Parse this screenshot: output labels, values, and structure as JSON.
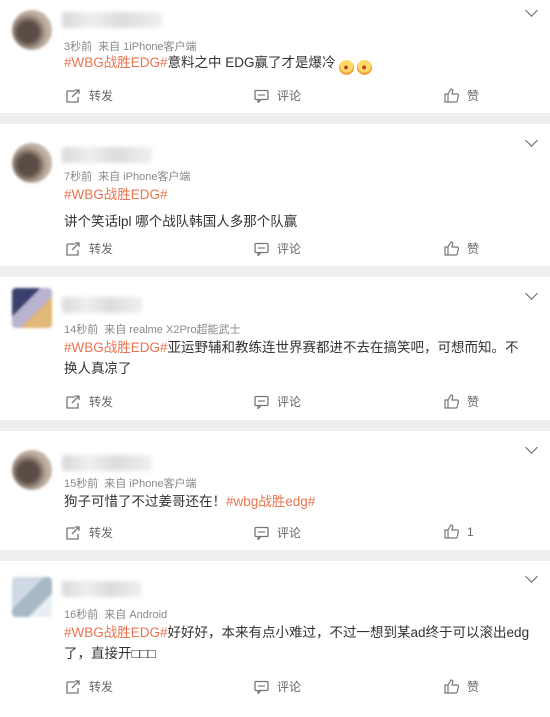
{
  "posts": [
    {
      "meta_time": "3秒前",
      "meta_source": "来自 1iPhone客户端",
      "hashtag": "#WBG战胜EDG#",
      "text": "意料之中 EDG赢了才是爆冷",
      "emojis": [
        "吃瓜",
        "吃瓜"
      ],
      "repost": "转发",
      "comment": "评论",
      "like": "赞"
    },
    {
      "meta_time": "7秒前",
      "meta_source": "来自 iPhone客户端",
      "hashtag": "#WBG战胜EDG#",
      "text": "讲个笑话lpl 哪个战队韩国人多那个队赢",
      "repost": "转发",
      "comment": "评论",
      "like": "赞"
    },
    {
      "meta_time": "14秒前",
      "meta_source": "来自 realme X2Pro超能武士",
      "hashtag": "#WBG战胜EDG#",
      "text": "亚运野辅和教练连世界赛都进不去在搞笑吧，可想而知。不换人真凉了",
      "repost": "转发",
      "comment": "评论",
      "like": "赞"
    },
    {
      "meta_time": "15秒前",
      "meta_source": "来自 iPhone客户端",
      "text_before": "狗子可惜了不过姜哥还在！",
      "hashtag": "#wbg战胜edg#",
      "repost": "转发",
      "comment": "评论",
      "like": "1"
    },
    {
      "meta_time": "16秒前",
      "meta_source": "来自 Android",
      "hashtag": "#WBG战胜EDG#",
      "text": "好好好，本来有点小难过，不过一想到某ad终于可以滚出edg了，直接开□□□",
      "repost": "转发",
      "comment": "评论",
      "like": "赞"
    }
  ],
  "colors": {
    "hashtag": "#eb7350",
    "background": "#eeeeee",
    "card": "#ffffff",
    "meta": "#888888"
  },
  "icons": [
    "chevron-down-icon",
    "repost-icon",
    "comment-icon",
    "like-icon",
    "emoji-icon"
  ]
}
